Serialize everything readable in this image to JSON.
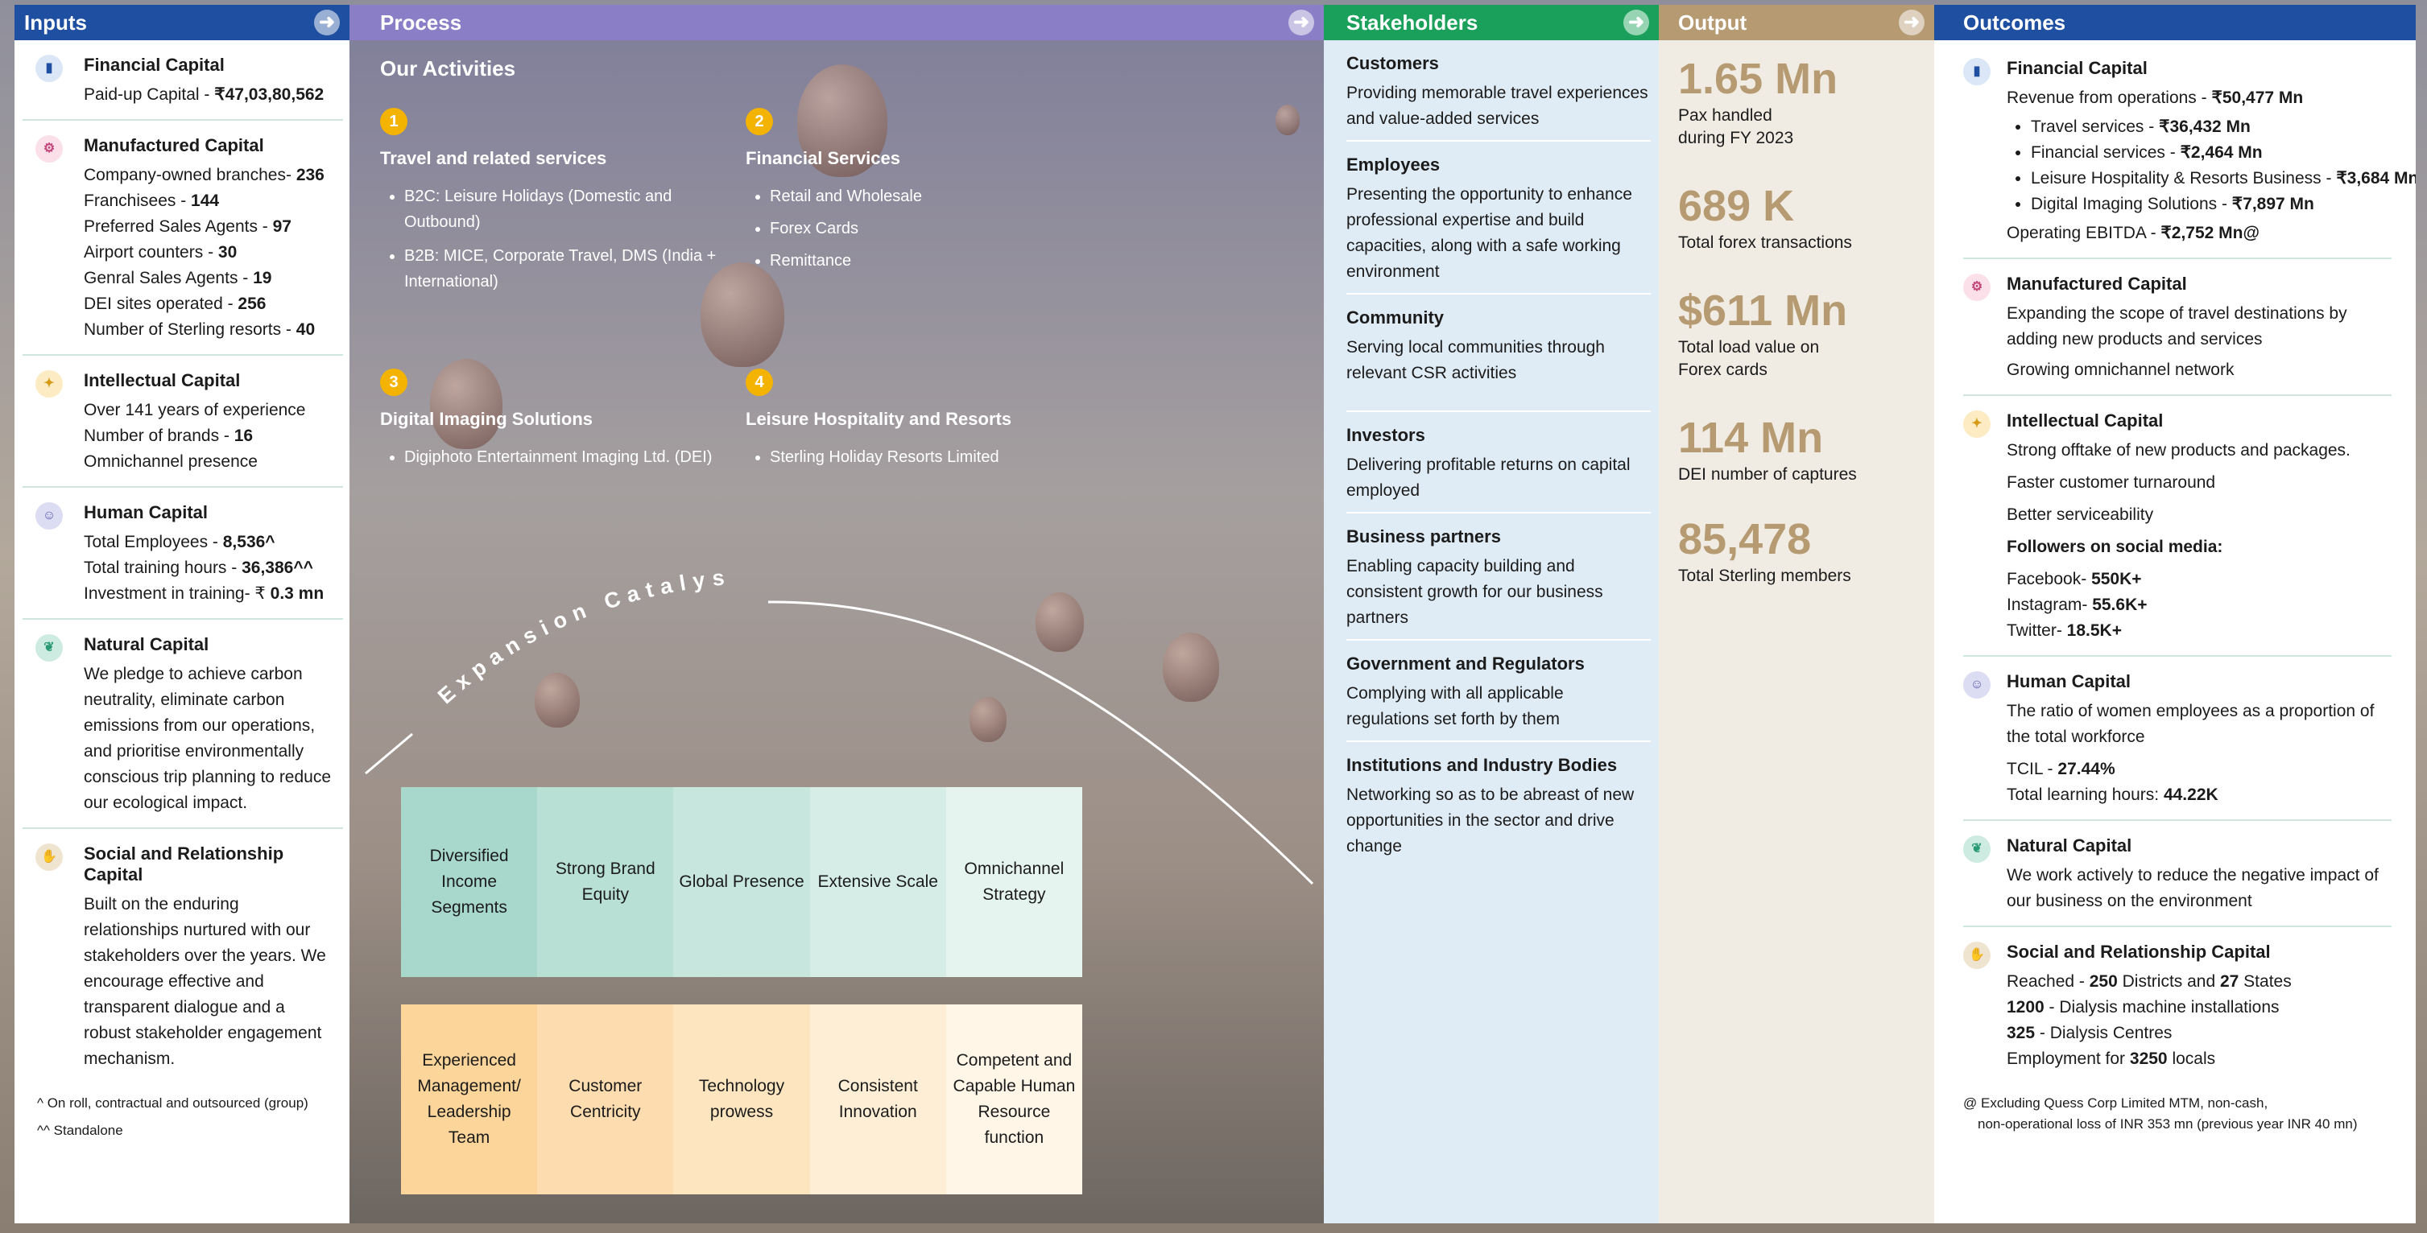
{
  "colors": {
    "inputs_header": "#1f4fa0",
    "process_header": "#8a7fc6",
    "stakeholders_header": "#1aa05a",
    "output_header": "#b59a72",
    "outcomes_header": "#1f4fa0",
    "number_badge": "#f4b300",
    "catalyst_row1": [
      "#a7d8cb",
      "#b9e0d5",
      "#c7e6dd",
      "#d6ede7",
      "#e6f4f0"
    ],
    "catalyst_row2": [
      "#fcd59a",
      "#fddcaf",
      "#fde5c0",
      "#feeed5",
      "#fff6e8"
    ]
  },
  "inputs": {
    "title": "Inputs",
    "sections": [
      {
        "icon": "chart-icon",
        "title": "Financial Capital",
        "lines": [
          {
            "t": "Paid-up Capital - ",
            "b": "₹47,03,80,562"
          }
        ]
      },
      {
        "icon": "factory-icon",
        "title": "Manufactured Capital",
        "lines": [
          {
            "t": "Company-owned branches- ",
            "b": "236"
          },
          {
            "t": "Franchisees - ",
            "b": "144"
          },
          {
            "t": "Preferred Sales Agents - ",
            "b": "97"
          },
          {
            "t": "Airport counters - ",
            "b": "30"
          },
          {
            "t": "Genral Sales Agents - ",
            "b": "19"
          },
          {
            "t": "DEI sites operated - ",
            "b": "256"
          },
          {
            "t": "Number of Sterling resorts - ",
            "b": "40"
          }
        ]
      },
      {
        "icon": "lightbulb-icon",
        "title": "Intellectual Capital",
        "lines": [
          {
            "t": "Over 141 years of experience",
            "b": ""
          },
          {
            "t": "Number of brands - ",
            "b": "16"
          },
          {
            "t": "Omnichannel presence",
            "b": ""
          }
        ]
      },
      {
        "icon": "people-icon",
        "title": "Human Capital",
        "lines": [
          {
            "t": "Total Employees - ",
            "b": "8,536^"
          },
          {
            "t": "Total training hours - ",
            "b": "36,386^^"
          },
          {
            "t": "Investment in training- ₹ ",
            "b": "0.3 mn"
          }
        ]
      },
      {
        "icon": "leaf-icon",
        "title": "Natural Capital",
        "text": "We pledge to achieve carbon neutrality, eliminate carbon emissions from our operations, and prioritise environmentally conscious trip planning to reduce our ecological impact."
      },
      {
        "icon": "handshake-icon",
        "title": "Social and Relationship Capital",
        "text": "Built on the enduring relationships nurtured with our stakeholders over the years. We encourage effective and transparent dialogue and a robust stakeholder engagement mechanism."
      }
    ],
    "footnotes": [
      "^ On roll, contractual and outsourced (group)",
      "^^ Standalone"
    ]
  },
  "process": {
    "title": "Process",
    "activities_title": "Our Activities",
    "activities": [
      {
        "num": "1",
        "title": "Travel and related services",
        "items": [
          "B2C: Leisure Holidays (Domestic and Outbound)",
          "B2B: MICE, Corporate Travel, DMS (India + International)"
        ]
      },
      {
        "num": "2",
        "title": "Financial Services",
        "items": [
          "Retail and Wholesale",
          "Forex Cards",
          "Remittance"
        ]
      },
      {
        "num": "3",
        "title": "Digital Imaging Solutions",
        "items": [
          "Digiphoto Entertainment Imaging Ltd. (DEI)"
        ]
      },
      {
        "num": "4",
        "title": "Leisure Hospitality and Resorts",
        "items": [
          "Sterling Holiday Resorts Limited"
        ]
      }
    ],
    "catalysts_title": "Expansion Catalysts",
    "catalysts_row1": [
      "Diversified Income Segments",
      "Strong Brand Equity",
      "Global Presence",
      "Extensive Scale",
      "Omnichannel Strategy"
    ],
    "catalysts_row2": [
      "Experienced Management/ Leadership Team",
      "Customer Centricity",
      "Technology prowess",
      "Consistent Innovation",
      "Competent and Capable Human Resource function"
    ]
  },
  "stakeholders": {
    "title": "Stakeholders",
    "items": [
      {
        "title": "Customers",
        "text": "Providing memorable travel experiences and value-added services"
      },
      {
        "title": "Employees",
        "text": "Presenting the opportunity to enhance professional expertise and build capacities, along with a safe working environment"
      },
      {
        "title": "Community",
        "text": "Serving local communities through relevant CSR activities"
      },
      {
        "title": "Investors",
        "text": "Delivering profitable returns on capital employed"
      },
      {
        "title": "Business partners",
        "text": "Enabling capacity building and consistent growth for our business partners"
      },
      {
        "title": "Government and Regulators",
        "text": "Complying with all applicable regulations set forth by them"
      },
      {
        "title": "Institutions and Industry Bodies",
        "text": "Networking so as to be abreast of new opportunities in the sector and drive change"
      }
    ]
  },
  "output": {
    "title": "Output",
    "items": [
      {
        "value": "1.65 Mn",
        "label": "Pax handled during FY 2023"
      },
      {
        "value": "689 K",
        "label": "Total forex transactions"
      },
      {
        "value": "$611 Mn",
        "label": "Total load value on Forex cards"
      },
      {
        "value": "114 Mn",
        "label": "DEI number of captures"
      },
      {
        "value": "85,478",
        "label": "Total Sterling members"
      }
    ]
  },
  "outcomes": {
    "title": "Outcomes",
    "financial": {
      "title": "Financial Capital",
      "revenue_label": "Revenue from operations - ",
      "revenue_value": "₹50,477 Mn",
      "bullets": [
        {
          "t": "Travel services - ",
          "b": "₹36,432 Mn"
        },
        {
          "t": "Financial services - ",
          "b": "₹2,464 Mn"
        },
        {
          "t": "Leisure Hospitality & Resorts Business - ",
          "b": "₹3,684 Mn"
        },
        {
          "t": "Digital Imaging Solutions - ",
          "b": "₹7,897 Mn"
        }
      ],
      "ebitda_label": "Operating EBITDA - ",
      "ebitda_value": "₹2,752 Mn@"
    },
    "manufactured": {
      "title": "Manufactured Capital",
      "lines": [
        "Expanding the scope of travel destinations by adding new products and services",
        "Growing omnichannel network"
      ]
    },
    "intellectual": {
      "title": "Intellectual Capital",
      "lines": [
        "Strong offtake of new products and packages.",
        "Faster customer turnaround",
        "Better serviceability"
      ],
      "social_title": "Followers on social media:",
      "social": [
        {
          "t": "Facebook- ",
          "b": "550K+"
        },
        {
          "t": "Instagram- ",
          "b": "55.6K+"
        },
        {
          "t": "Twitter- ",
          "b": "18.5K+"
        }
      ]
    },
    "human": {
      "title": "Human Capital",
      "text": "The ratio of women employees as a proportion of the total workforce",
      "lines": [
        {
          "t": "TCIL - ",
          "b": "27.44%"
        },
        {
          "t": "Total learning hours: ",
          "b": "44.22K"
        }
      ]
    },
    "natural": {
      "title": "Natural Capital",
      "text": "We work actively to reduce the negative impact of our business on the environment"
    },
    "social": {
      "title": "Social and Relationship Capital",
      "lines": [
        {
          "p1": "Reached - ",
          "b1": "250",
          "p2": " Districts and ",
          "b2": "27",
          "p3": " States"
        },
        {
          "p1": "",
          "b1": "1200",
          "p2": " - Dialysis machine installations",
          "b2": "",
          "p3": ""
        },
        {
          "p1": "",
          "b1": "325",
          "p2": " - Dialysis Centres",
          "b2": "",
          "p3": ""
        },
        {
          "p1": "Employment for ",
          "b1": "3250",
          "p2": " locals",
          "b2": "",
          "p3": ""
        }
      ]
    },
    "footnote_1": "@ Excluding Quess Corp Limited MTM, non-cash,",
    "footnote_2": "non-operational loss of INR 353 mn (previous year INR 40 mn)"
  }
}
